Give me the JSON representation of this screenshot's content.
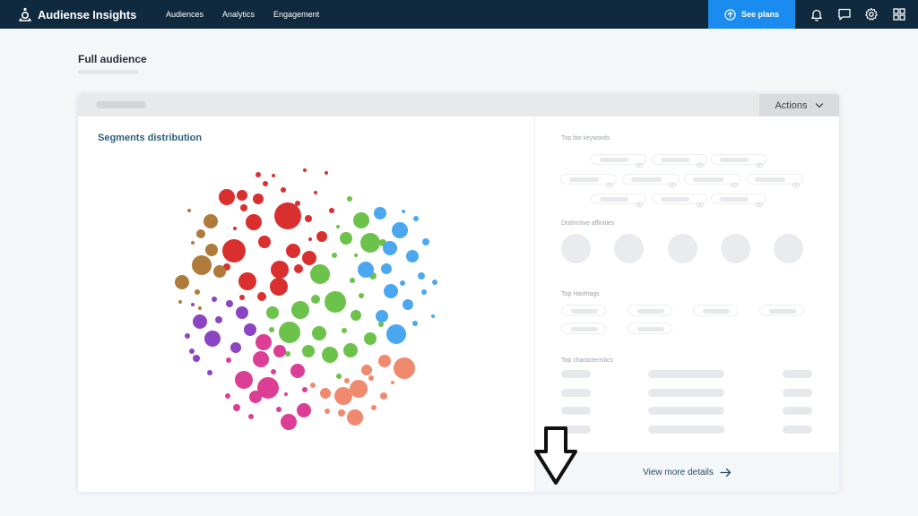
{
  "brand": {
    "name": "Audiense Insights"
  },
  "nav": {
    "items": [
      {
        "label": "Audiences"
      },
      {
        "label": "Analytics"
      },
      {
        "label": "Engagement"
      }
    ]
  },
  "topbar": {
    "see_plans": "See plans",
    "icons": [
      "bell-icon",
      "chat-icon",
      "gear-icon",
      "apps-grid-icon"
    ]
  },
  "page": {
    "title": "Full audience"
  },
  "card": {
    "actions_label": "Actions",
    "segments_title": "Segments distribution",
    "sections": {
      "top_bio_keywords": "Top bio keywords",
      "distinctive_affinities": "Distinctive affinities",
      "top_hashtags": "Top Hashtags",
      "top_characteristics": "Top characteristics"
    },
    "view_more": "View more details"
  },
  "colors": {
    "topbar_bg": "#0f2a3e",
    "accent": "#1a8cf0",
    "segment_red": "#d9302f",
    "segment_brown": "#b07a3a",
    "segment_green": "#6cc24a",
    "segment_blue": "#4ba8f0",
    "segment_purple": "#8b45c2",
    "segment_pink": "#dd3e95",
    "segment_salmon": "#f08a6e"
  }
}
